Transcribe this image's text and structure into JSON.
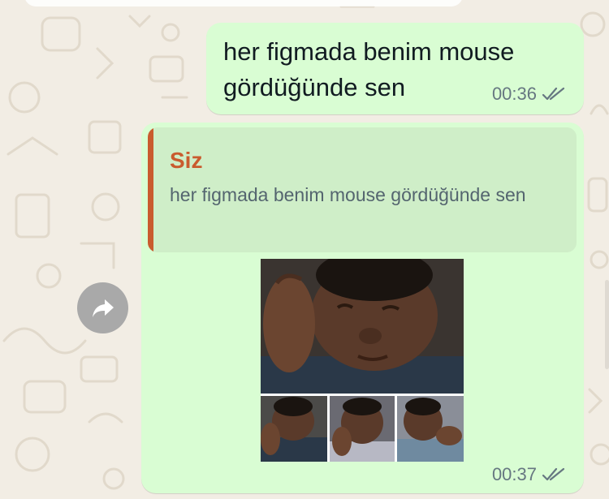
{
  "messages": [
    {
      "direction": "outgoing",
      "text": "her figmada benim mouse gördüğünde sen",
      "time": "00:36",
      "status_icon": "double-check-icon"
    },
    {
      "direction": "outgoing",
      "reply": {
        "author": "Siz",
        "text": "her figmada benim mouse gördüğünde sen"
      },
      "attachment": {
        "type": "image",
        "description_icon": "meme-image"
      },
      "time": "00:37",
      "status_icon": "double-check-icon"
    }
  ],
  "forward_button": {
    "icon": "forward-arrow-icon"
  },
  "colors": {
    "wallpaper": "#f2ede4",
    "outgoing_bubble": "#d9fdd3",
    "quote_background": "#cfeec8",
    "quote_accent": "#c95b2e",
    "meta_text": "#667781",
    "forward_button": "#a9a9a9"
  }
}
